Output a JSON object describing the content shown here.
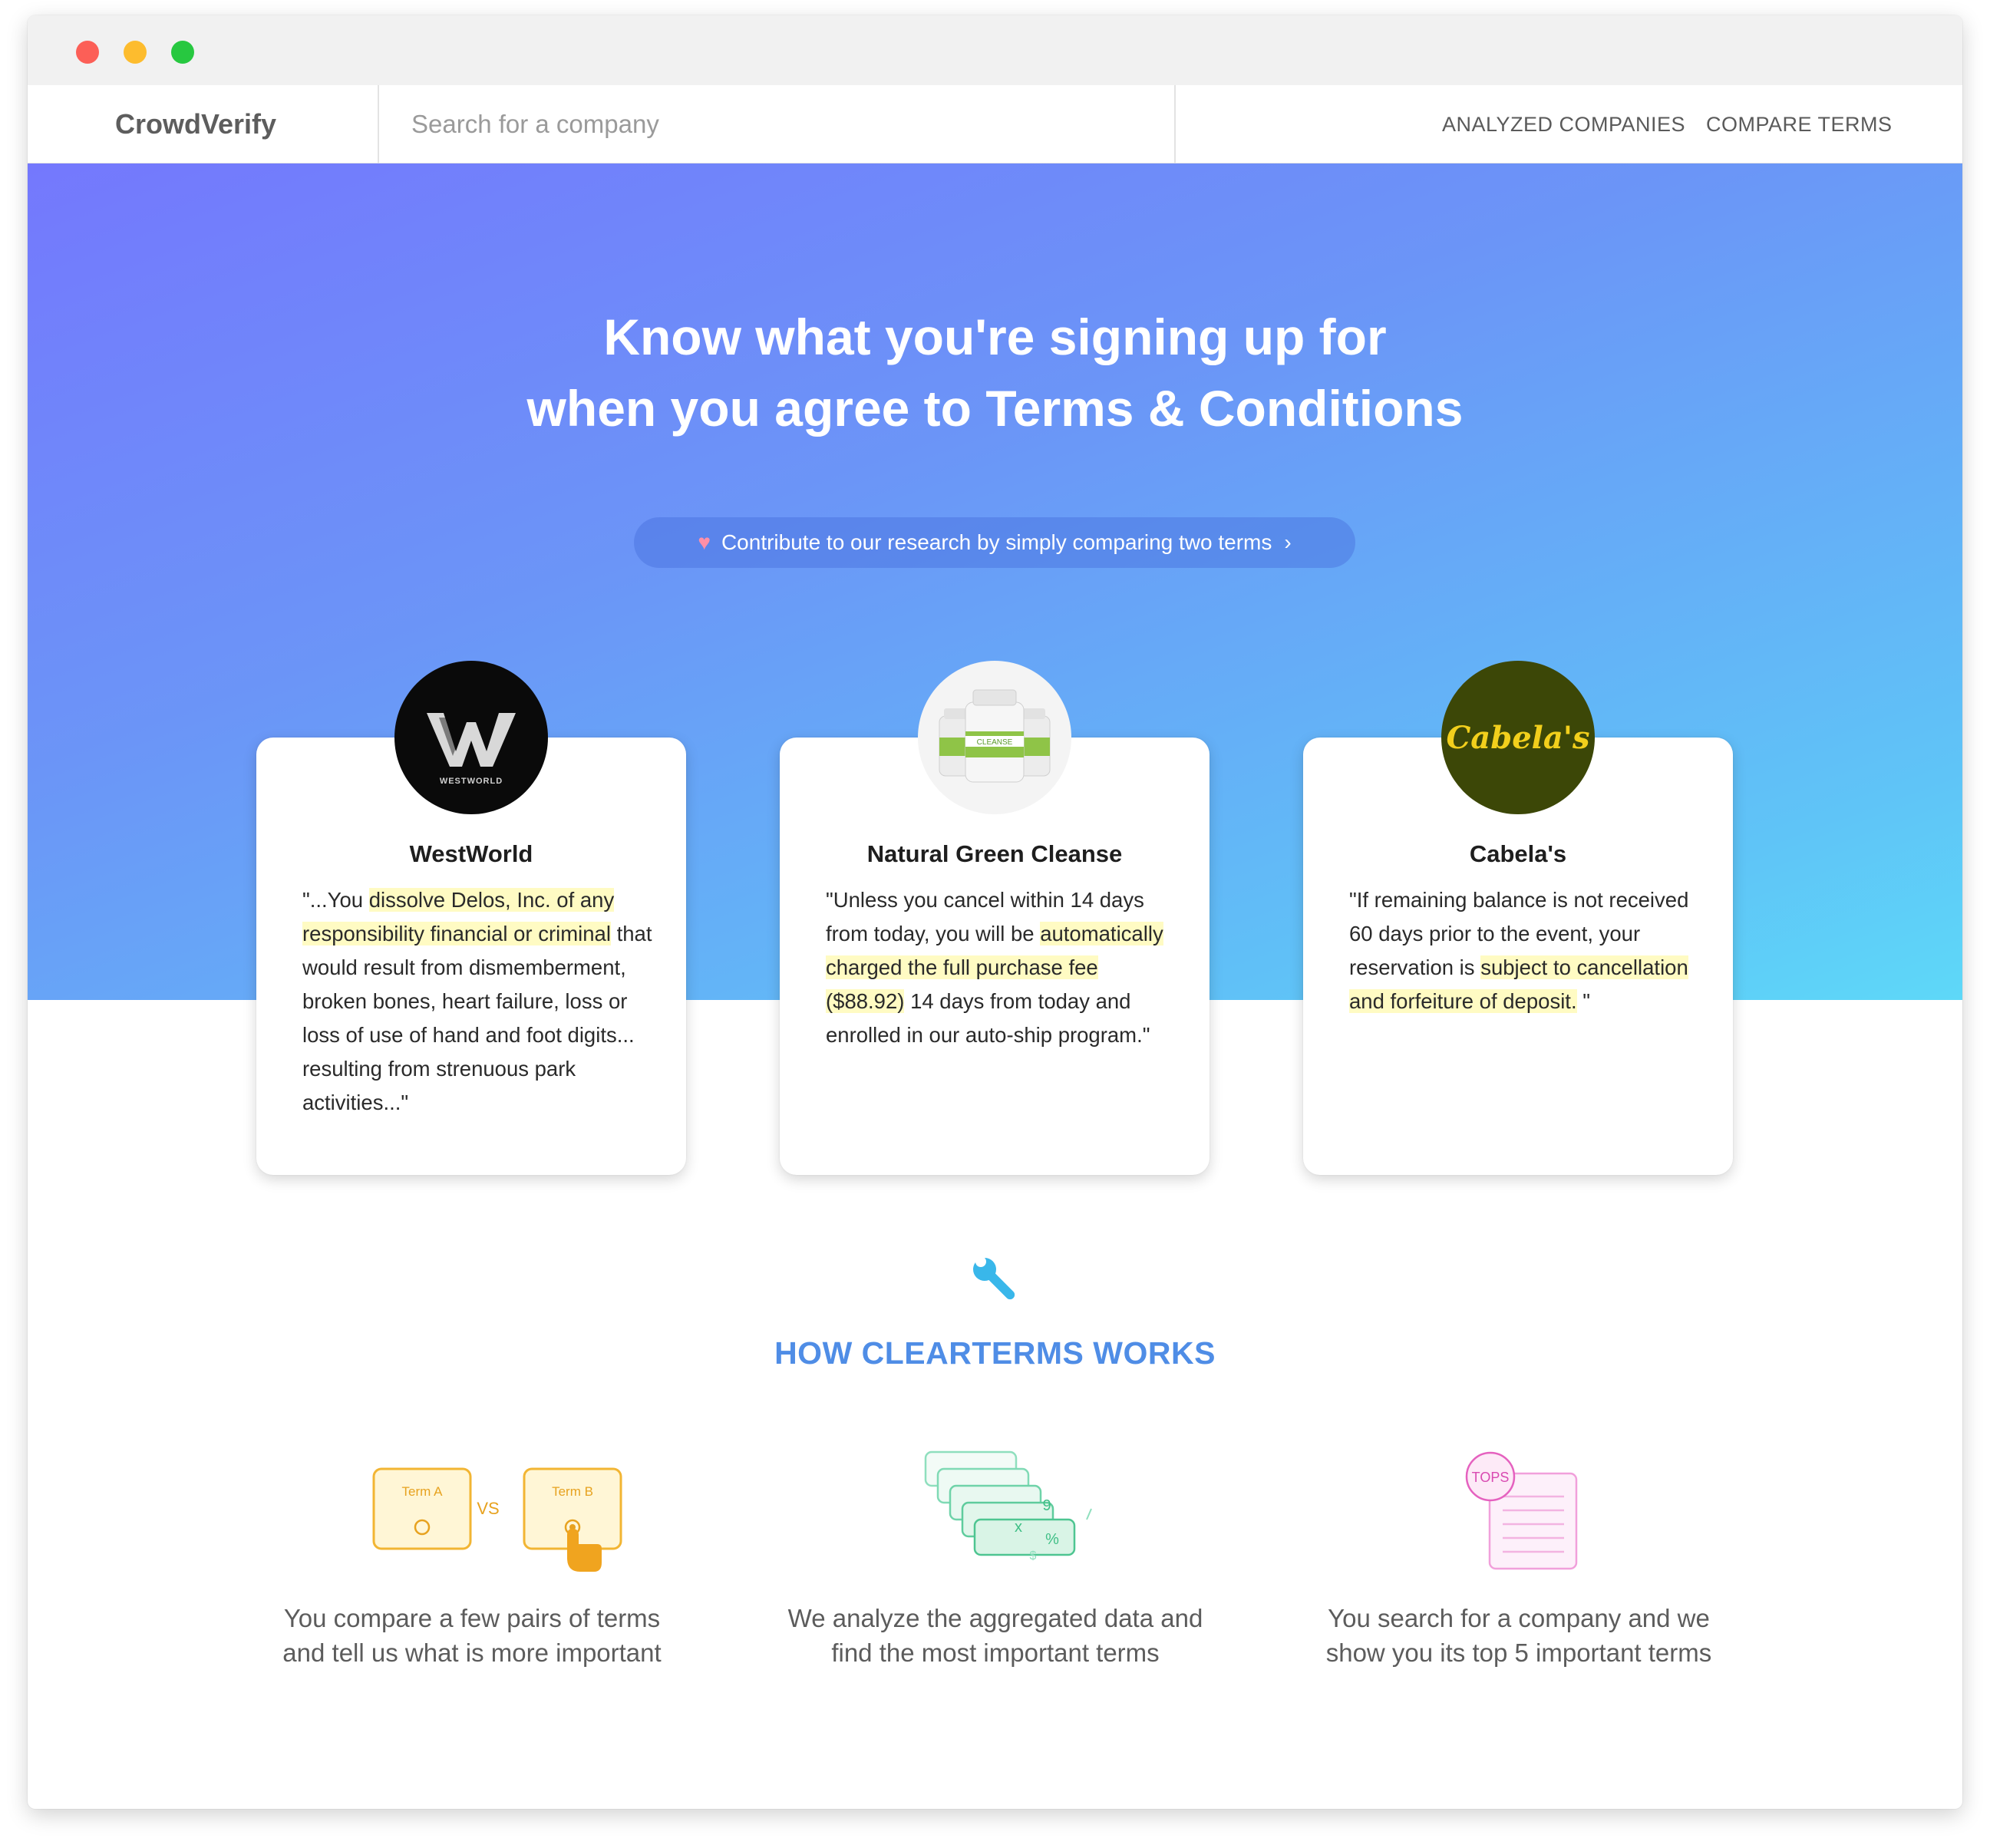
{
  "navbar": {
    "brand": "CrowdVerify",
    "search_placeholder": "Search for a company",
    "links": [
      "ANALYZED COMPANIES",
      "COMPARE TERMS"
    ]
  },
  "hero": {
    "title_line1": "Know what you're signing up for",
    "title_line2": "when you agree to Terms & Conditions",
    "contribute_label": "Contribute to our research by simply comparing two terms",
    "contribute_icon": "heart-icon",
    "contribute_chevron": "chevron-right-icon"
  },
  "cards": [
    {
      "name": "WestWorld",
      "logo_text": "WESTWORLD",
      "quote_parts": [
        "\"...You ",
        "dissolve Delos, Inc. of any responsibility financial or criminal",
        " that would result from dismemberment, broken bones, heart failure, loss or loss of use of hand and foot digits... resulting from strenuous park activities...\""
      ]
    },
    {
      "name": "Natural Green Cleanse",
      "logo_text": "CLEANSE",
      "quote_parts": [
        "\"Unless you cancel within 14 days from today, you will be ",
        "automatically charged the full purchase fee ($88.92)",
        " 14 days from today and enrolled in our auto-ship program.\""
      ]
    },
    {
      "name": "Cabela's",
      "logo_text": "Cabela's",
      "quote_parts": [
        "\"If remaining balance is not received 60 days prior to the event, your reservation is ",
        "subject to cancellation and forfeiture of deposit.",
        " \""
      ]
    }
  ],
  "how": {
    "icon": "wrench-icon",
    "title": "HOW CLEARTERMS WORKS",
    "steps": [
      {
        "line1": "You compare a few pairs of terms",
        "line2": "and tell us what is more important",
        "illus": {
          "term_a": "Term A",
          "vs": "VS",
          "term_b": "Term B"
        }
      },
      {
        "line1": "We analyze the aggregated data and",
        "line2": "find the most important terms",
        "illus": {
          "sym1": "9",
          "sym2": "x",
          "sym3": "%",
          "sym4": "$"
        }
      },
      {
        "line1": "You search for a company and we",
        "line2": "show you its top 5 important terms",
        "illus": {
          "badge": "TOPS"
        }
      }
    ]
  },
  "colors": {
    "accent": "#4f8de6",
    "highlight": "#fffbc3",
    "gradient_start": "#7478fd",
    "gradient_end": "#5ed8f8"
  }
}
